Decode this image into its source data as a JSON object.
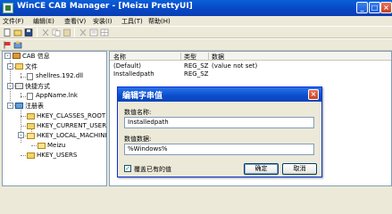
{
  "window": {
    "title": "WinCE CAB Manager - [Meizu PrettyUI]",
    "minimize": "_",
    "maximize": "□",
    "close": "×"
  },
  "menu": [
    "文件(F)",
    "编辑(E)",
    "查看(V)",
    "安装(I)",
    "工具(T)",
    "帮助(H)"
  ],
  "toolbar1_icons": [
    "new-icon",
    "open-icon",
    "save-icon",
    "cut-icon",
    "copy-icon",
    "paste-icon",
    "delete-icon",
    "properties-icon",
    "grid-icon"
  ],
  "toolbar2_icons": [
    "flag-icon",
    "install-icon"
  ],
  "tree": {
    "root": "CAB 信息",
    "files": "文件",
    "file_item": "shellres.192.dll",
    "shortcuts": "快捷方式",
    "shortcut_item": "AppName.lnk",
    "registry": "注册表",
    "hkcr": "HKEY_CLASSES_ROOT",
    "hkcu": "HKEY_CURRENT_USER",
    "hklm": "HKEY_LOCAL_MACHINE",
    "meizu": "Meizu",
    "hku": "HKEY_USERS"
  },
  "list": {
    "columns": [
      "名称",
      "类型",
      "数据"
    ],
    "rows": [
      {
        "name": "(Default)",
        "type": "REG_SZ",
        "data": "(value not set)"
      },
      {
        "name": "Installedpath",
        "type": "REG_SZ",
        "data": ""
      }
    ]
  },
  "dialog": {
    "title": "编辑字串值",
    "name_label": "数值名称:",
    "name_value": "Installedpath",
    "data_label": "数值数据:",
    "data_value": "%Windows%",
    "checkbox_label": "覆盖已有的值",
    "ok": "确定",
    "cancel": "取消"
  }
}
